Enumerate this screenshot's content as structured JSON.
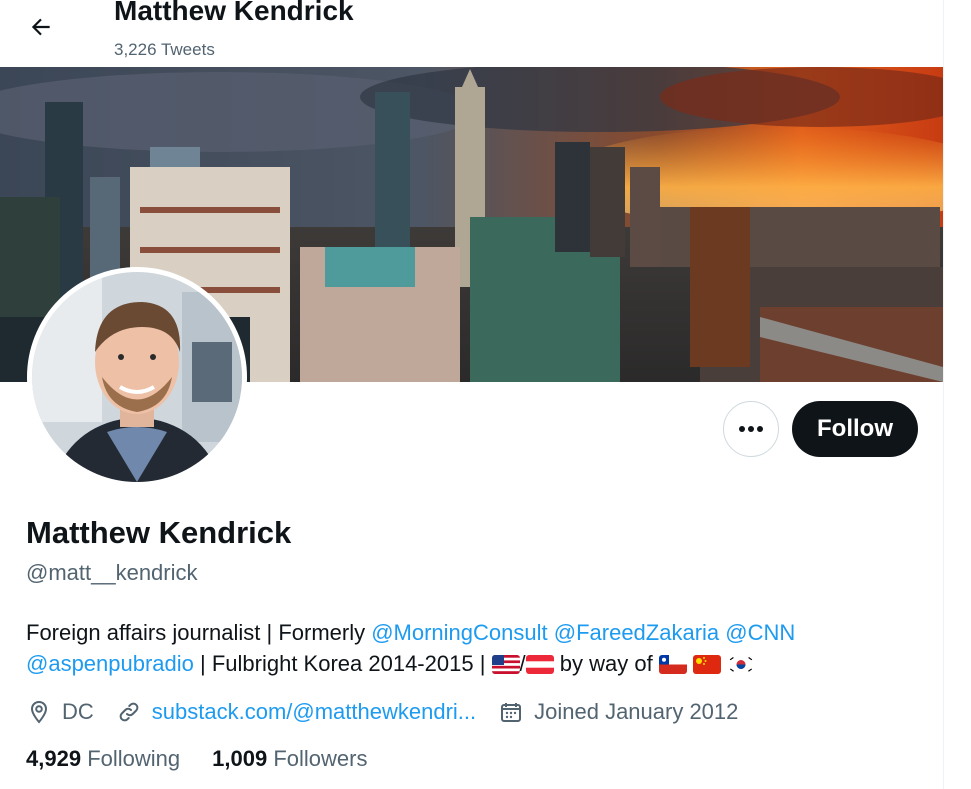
{
  "header": {
    "title": "Matthew Kendrick",
    "tweet_count": "3,226 Tweets"
  },
  "profile": {
    "display_name": "Matthew Kendrick",
    "handle": "@matt__kendrick",
    "bio": {
      "part1": "Foreign affairs journalist | Formerly ",
      "mention1": "@MorningConsult",
      "mention2": "@FareedZakaria",
      "mention3": "@CNN",
      "mention4": "@aspenpubradio",
      "part2": " | Fulbright Korea 2014-2015 | ",
      "slash": "/",
      "part3": " by way of "
    },
    "location": "DC",
    "website": "substack.com/@matthewkendri...",
    "joined": "Joined January 2012",
    "following_count": "4,929",
    "following_label": "Following",
    "followers_count": "1,009",
    "followers_label": "Followers"
  },
  "actions": {
    "follow_label": "Follow"
  },
  "icons": {
    "back": "arrow-left-icon",
    "more": "more-dots-icon",
    "location": "location-pin-icon",
    "link": "link-icon",
    "calendar": "calendar-icon"
  },
  "colors": {
    "text": "#0f1419",
    "secondary": "#536471",
    "accent": "#1d9bf0",
    "follow_bg": "#0f1419"
  }
}
